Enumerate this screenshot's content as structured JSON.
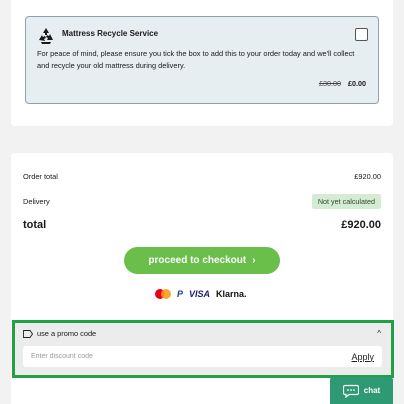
{
  "recycle": {
    "title": "Mattress Recycle Service",
    "description": "For peace of mind, please ensure you tick the box to add this to your order today and we'll collect and recycle your old mattress during delivery.",
    "old_price": "£30.00",
    "new_price": "£0.00",
    "checked": false
  },
  "summary": {
    "order_total_label": "Order total",
    "order_total_value": "£920.00",
    "delivery_label": "Delivery",
    "delivery_value": "Not yet calculated",
    "total_label": "total",
    "total_value": "£920.00"
  },
  "checkout": {
    "label": "proceed to checkout",
    "chevron": "›"
  },
  "payments": {
    "paypal": "P",
    "visa": "VISA",
    "klarna": "Klarna."
  },
  "promo": {
    "label": "use a promo code",
    "placeholder": "Enter discount code",
    "value": "",
    "apply_label": "Apply",
    "collapse_glyph": "^"
  },
  "chat": {
    "label": "chat"
  },
  "colors": {
    "checkout_green": "#6abf4b",
    "promo_highlight": "#22a045",
    "chat_green": "#2e9a74",
    "recycle_bg": "#e6eef2"
  }
}
